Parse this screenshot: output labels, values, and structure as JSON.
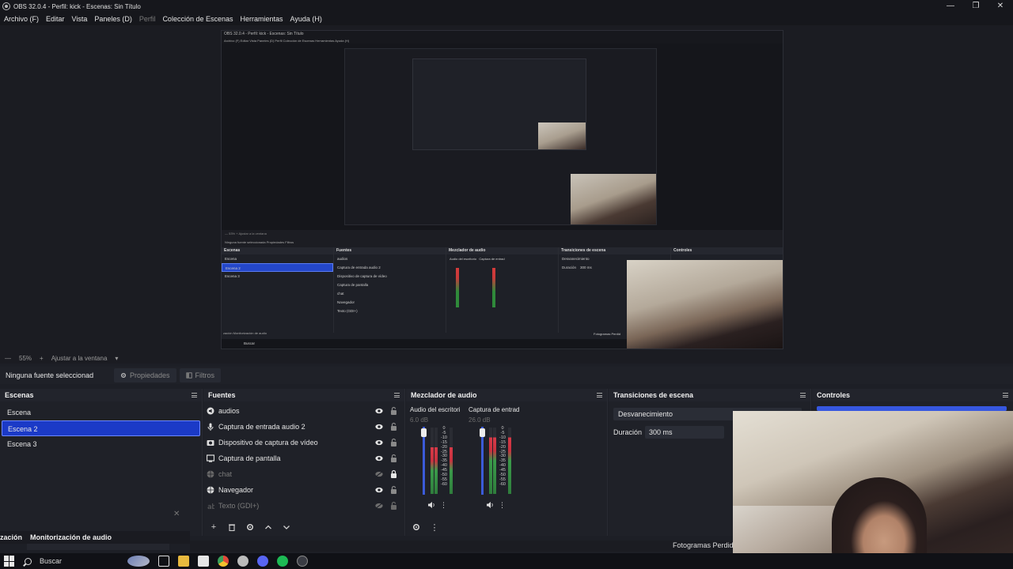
{
  "window": {
    "title": "OBS 32.0.4 - Perfil: kick - Escenas: Sin Título",
    "controls": [
      "—",
      "❐",
      "✕"
    ]
  },
  "menu": {
    "items": [
      "Archivo (F)",
      "Editar",
      "Vista",
      "Paneles (D)",
      "Perfil",
      "Colección de Escenas",
      "Herramientas",
      "Ayuda (H)"
    ]
  },
  "preview": {
    "nested_title": "OBS 32.0.4 - Perfil: kick - Escenas: Sin Título",
    "nested_menu": "Archivo (F)   Editar   Vista   Paneles (D)   Perfil   Colección de Escenas   Herramientas   Ayuda (H)",
    "nested_zoom": "— 53%   +   Ajustar a la ventana",
    "nested_source_bar": "Ninguna fuente seleccionada      Propiedades      Filtros",
    "nested_docks": {
      "scenes_title": "Escenas",
      "scenes": [
        "Escena",
        "Escena 2",
        "Escena 3"
      ],
      "sources_title": "Fuentes",
      "sources": [
        "audios",
        "Captura de entrada audio 2",
        "Dispositivo de captura de vídeo",
        "Captura de pantalla",
        "chat",
        "Navegador",
        "Texto (GDI+)"
      ],
      "mixer_title": "Mezclador de audio",
      "mixer_ch1": "Audio del escritorio",
      "mixer_ch2": "Captura de entrad",
      "transitions_title": "Transiciones de escena",
      "transition": "Desvanecimiento",
      "duration_label": "Duración",
      "duration_value": "300 ms",
      "controls_title": "Controles",
      "monitor": "zación   Monitorización de audio",
      "fps": "Fotogramas Perdid",
      "search": "Buscar"
    }
  },
  "zoom": {
    "minus": "—",
    "value": "55%",
    "plus": "+",
    "fit": "Ajustar a la ventana"
  },
  "context": {
    "no_source": "Ninguna fuente seleccionad",
    "properties": "Propiedades",
    "filters": "Filtros"
  },
  "scenes": {
    "title": "Escenas",
    "items": [
      "Escena",
      "Escena 2",
      "Escena 3"
    ],
    "selected_index": 1
  },
  "sources": {
    "title": "Fuentes",
    "items": [
      {
        "label": "audios",
        "icon": "audio-icon",
        "visible": true,
        "locked": false
      },
      {
        "label": "Captura de entrada audio 2",
        "icon": "microphone-icon",
        "visible": true,
        "locked": false
      },
      {
        "label": "Dispositivo de captura de vídeo",
        "icon": "camera-icon",
        "visible": true,
        "locked": false
      },
      {
        "label": "Captura de pantalla",
        "icon": "monitor-icon",
        "visible": true,
        "locked": false
      },
      {
        "label": "chat",
        "icon": "browser-icon",
        "visible": false,
        "locked": true
      },
      {
        "label": "Navegador",
        "icon": "browser-icon",
        "visible": true,
        "locked": false
      },
      {
        "label": "Texto (GDI+)",
        "icon": "text-icon",
        "visible": false,
        "locked": false
      }
    ]
  },
  "mixer": {
    "title": "Mezclador de audio",
    "channels": [
      {
        "name": "Audio del escritori",
        "db": "6.0 dB",
        "level": 0.7
      },
      {
        "name": "Captura de entrad",
        "db": "26.0 dB",
        "level": 0.85
      }
    ],
    "scale": [
      "0",
      "-5",
      "-10",
      "-15",
      "-20",
      "-25",
      "-30",
      "-35",
      "-40",
      "-45",
      "-50",
      "-55",
      "-60"
    ]
  },
  "transitions": {
    "title": "Transiciones de escena",
    "selected": "Desvanecimiento",
    "duration_label": "Duración",
    "duration_value": "300 ms"
  },
  "controls": {
    "title": "Controles"
  },
  "monitor": {
    "left": "zación",
    "title": "Monitorización de audio",
    "close": "✕"
  },
  "stats": {
    "fps_label": "Fotogramas Perdid"
  },
  "taskbar": {
    "search": "Buscar"
  },
  "colors": {
    "selection": "#1b3ac7",
    "panel": "#1f2128",
    "accent": "#3b5bd9"
  }
}
